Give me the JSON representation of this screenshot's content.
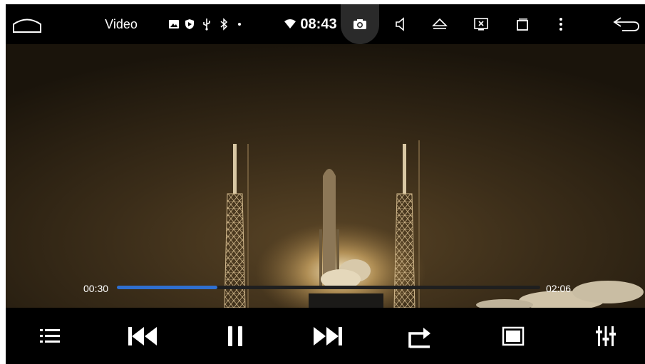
{
  "status_bar": {
    "app_title": "Video",
    "clock": "08:43",
    "icons": [
      "home-icon",
      "image-notification-icon",
      "shield-icon",
      "usb-icon",
      "bluetooth-icon",
      "dot-icon",
      "wifi-icon",
      "screenshot-camera-icon",
      "volume-icon",
      "eject-icon",
      "close-window-icon",
      "recent-apps-icon",
      "more-vert-icon",
      "back-icon"
    ]
  },
  "player": {
    "current_time": "00:30",
    "total_time": "02:06",
    "progress_fraction": 0.238
  },
  "controls": {
    "buttons": [
      "playlist-icon",
      "previous-icon",
      "pause-icon",
      "next-icon",
      "repeat-icon",
      "screen-mode-icon",
      "equalizer-icon"
    ]
  },
  "colors": {
    "progress": "#2f6fd0",
    "background": "#000000"
  }
}
